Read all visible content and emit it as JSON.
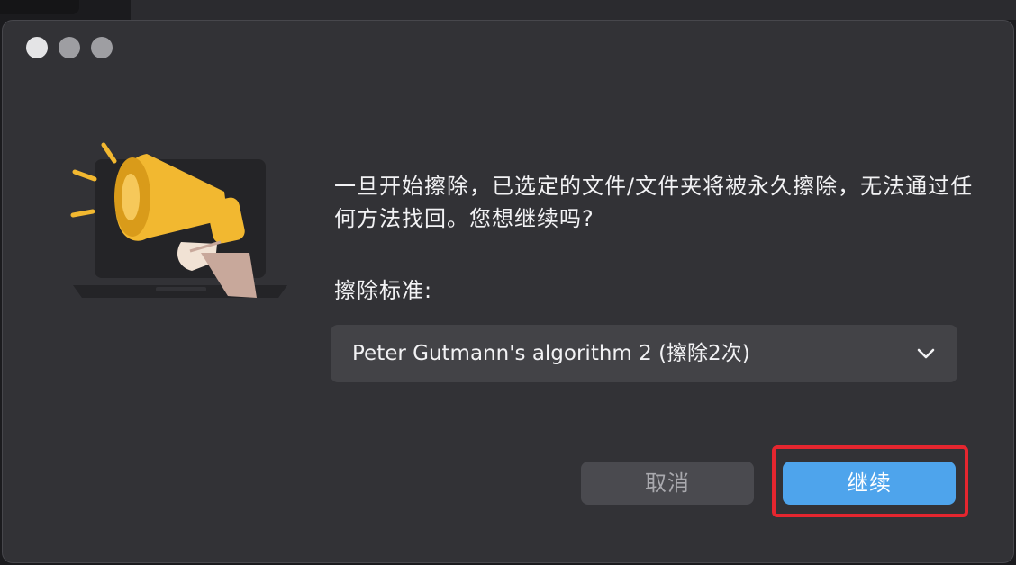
{
  "window": {
    "controls": [
      "close",
      "minimize",
      "maximize"
    ]
  },
  "dialog": {
    "message": "一旦开始擦除，已选定的文件/文件夹将被永久擦除，无法通过任何方法找回。您想继续吗?",
    "standard_label": "擦除标准:",
    "standard_select": {
      "value": "Peter Gutmann's algorithm 2 (擦除2次)"
    },
    "buttons": {
      "cancel": "取消",
      "continue": "继续"
    }
  },
  "colors": {
    "dialog_bg": "#323236",
    "select_bg": "#434347",
    "cancel_bg": "#4a4a4f",
    "continue_bg": "#4ea4ec",
    "highlight": "#e5262f",
    "megaphone": "#f2b830"
  },
  "icons": {
    "illustration": "megaphone-laptop-illustration",
    "chevron": "chevron-down-icon"
  }
}
